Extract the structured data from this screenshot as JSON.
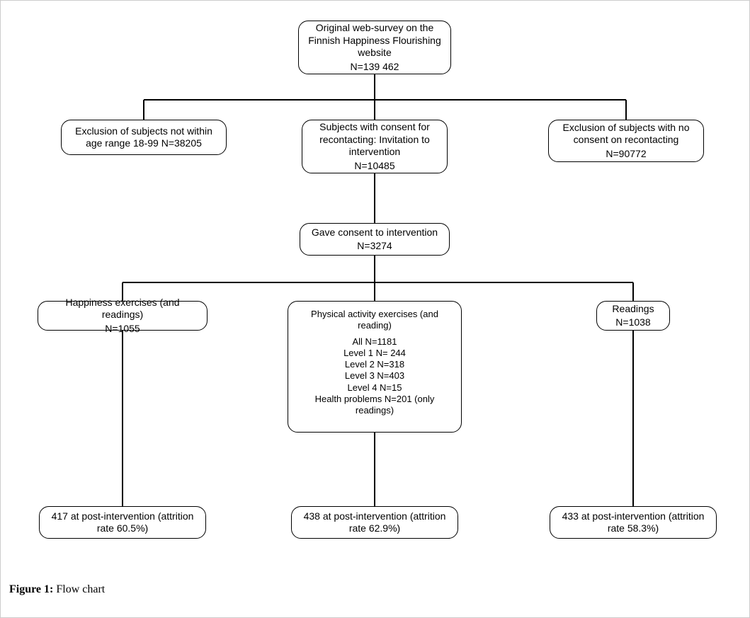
{
  "caption": {
    "label": "Figure 1:",
    "text": " Flow chart"
  },
  "nodes": {
    "root": {
      "line1": "Original web-survey on the",
      "line2": "Finnish Happiness Flourishing",
      "line3": "website",
      "n": "N=139 462"
    },
    "excl_age": {
      "line1": "Exclusion of subjects not within",
      "line2": "age range 18-99 N=38205"
    },
    "consent_recontact": {
      "line1": "Subjects with consent for",
      "line2": "recontacting: Invitation to",
      "line3": "intervention",
      "n": "N=10485"
    },
    "excl_consent": {
      "line1": "Exclusion of subjects with no",
      "line2": "consent on recontacting",
      "n": "N=90772"
    },
    "gave_consent": {
      "line1": "Gave consent to intervention",
      "n": "N=3274"
    },
    "happiness": {
      "line1": "Happiness exercises (and readings)",
      "n": "N=1055"
    },
    "physical": {
      "title1": "Physical activity exercises (and",
      "title2": "reading)",
      "all": "All N=1181",
      "l1": "Level 1 N= 244",
      "l2": "Level 2 N=318",
      "l3": "Level 3 N=403",
      "l4": "Level 4 N=15",
      "hp1": "Health problems N=201 (only",
      "hp2": "readings)"
    },
    "readings": {
      "line1": "Readings",
      "n": "N=1038"
    },
    "post_happiness": {
      "line1": "417 at post-intervention (attrition",
      "line2": "rate 60.5%)"
    },
    "post_physical": {
      "line1": "438 at post-intervention (attrition",
      "line2": "rate 62.9%)"
    },
    "post_readings": {
      "line1": "433 at post-intervention (attrition",
      "line2": "rate 58.3%)"
    }
  }
}
